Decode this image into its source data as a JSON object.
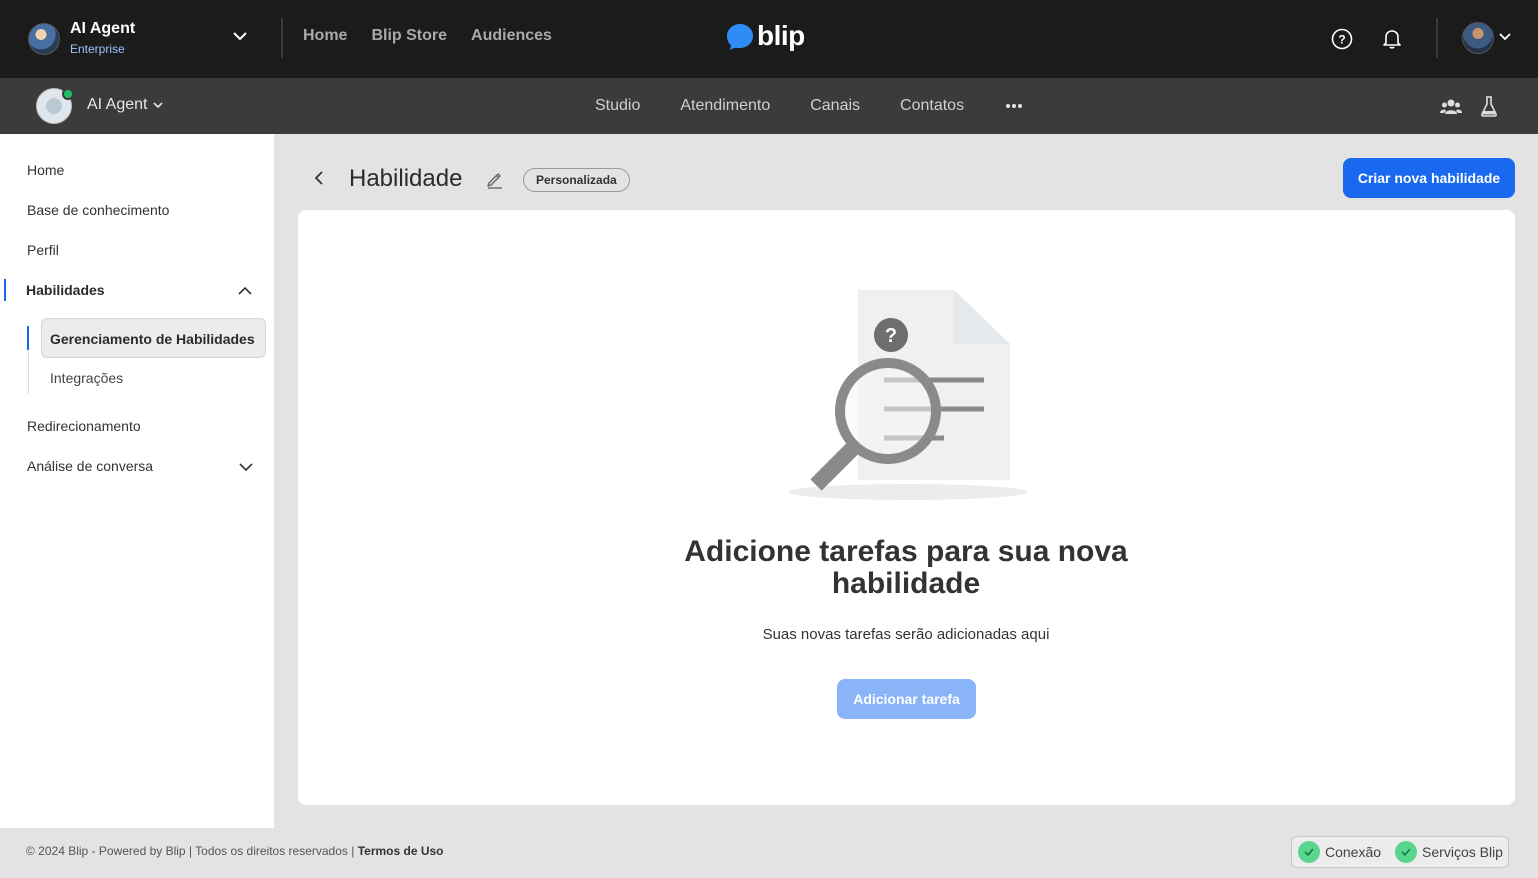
{
  "org": {
    "name": "AI Agent",
    "plan": "Enterprise"
  },
  "topnav": {
    "home": "Home",
    "store": "Blip Store",
    "audiences": "Audiences"
  },
  "logo": {
    "text": "blip"
  },
  "bot": {
    "name": "AI Agent"
  },
  "subnav": {
    "studio": "Studio",
    "atendimento": "Atendimento",
    "canais": "Canais",
    "contatos": "Contatos"
  },
  "sidebar": {
    "home": "Home",
    "base": "Base de conhecimento",
    "perfil": "Perfil",
    "habilidades": "Habilidades",
    "gerenciamento": "Gerenciamento de Habilidades",
    "integracoes": "Integrações",
    "redirecionamento": "Redirecionamento",
    "analise": "Análise de conversa"
  },
  "page": {
    "title": "Habilidade",
    "badge": "Personalizada",
    "create_button": "Criar nova habilidade"
  },
  "empty": {
    "title": "Adicione tarefas para sua nova habilidade",
    "subtitle": "Suas novas tarefas serão adicionadas aqui",
    "button": "Adicionar tarefa"
  },
  "footer": {
    "copyright": "© 2024 Blip - Powered by Blip | Todos os direitos reservados |",
    "terms": "Termos de Uso",
    "status1": "Conexão",
    "status2": "Serviços Blip"
  },
  "colors": {
    "primary": "#1968f0",
    "topbar": "#1b1b1b",
    "subbar": "#3b3b3b",
    "success": "#58d68d"
  }
}
